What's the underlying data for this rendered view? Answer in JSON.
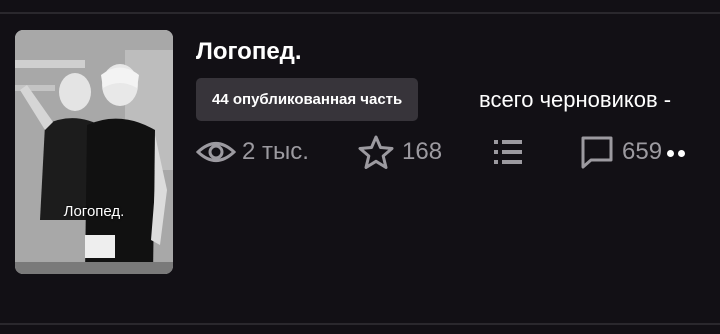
{
  "story": {
    "title": "Логопед.",
    "cover_text": "Логопед.",
    "parts_badge": "44 опубликованная часть",
    "drafts_text": "всего черновиков -",
    "stats": {
      "reads": "2 тыс.",
      "votes": "168",
      "comments": "659"
    }
  },
  "icons": {
    "reads": "eye-icon",
    "votes": "star-icon",
    "parts": "list-icon",
    "comments": "comment-icon",
    "more": "more-dots-icon"
  },
  "colors": {
    "background": "#121015",
    "badge": "#37343a",
    "stat_text": "#9c9aa0",
    "title": "#ffffff"
  }
}
